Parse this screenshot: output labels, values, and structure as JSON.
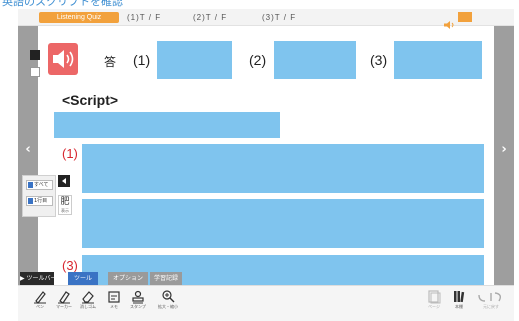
{
  "header": {
    "caption": "英語のスクリプトを確認"
  },
  "quiz_bar": {
    "chip_label": "Listening Quiz",
    "items": [
      "(1)T / F",
      "(2)T / F",
      "(3)T / F"
    ]
  },
  "answer_row": {
    "label": "答",
    "numbers": [
      "(1)",
      "(2)",
      "(3)"
    ]
  },
  "script": {
    "title": "<Script>",
    "paragraph_numbers": [
      "(1)",
      "(3)"
    ]
  },
  "filter_panel": {
    "row_1": "すべて",
    "row_2": "1行目"
  },
  "kanji_button": {
    "glyph": "肥",
    "sub": "表示"
  },
  "side_nav": {
    "prev": "‹",
    "next": "›"
  },
  "tabs": [
    {
      "label": "▶ ツールバー",
      "color": "#2a2a2a"
    },
    {
      "label": "ツール",
      "color": "#3a73c4"
    },
    {
      "label": "オプション",
      "color": "#9a9a9a"
    },
    {
      "label": "学習記録",
      "color": "#9a9a9a"
    }
  ],
  "toolbar": {
    "pen": "ペン",
    "marker": "マーカー",
    "eraser": "消しゴム",
    "note": "メモ",
    "stamp": "スタンプ",
    "zoom": "拡大・縮小",
    "pages": "ページ",
    "book": "本棚",
    "undo": "元に戻す"
  },
  "colors": {
    "answer_box": "#7fc4ee",
    "speaker": "#ec6767",
    "quiz_chip": "#f2a13c",
    "paragraph_number": "#d8262f",
    "side_nav": "#9e9e9e"
  }
}
